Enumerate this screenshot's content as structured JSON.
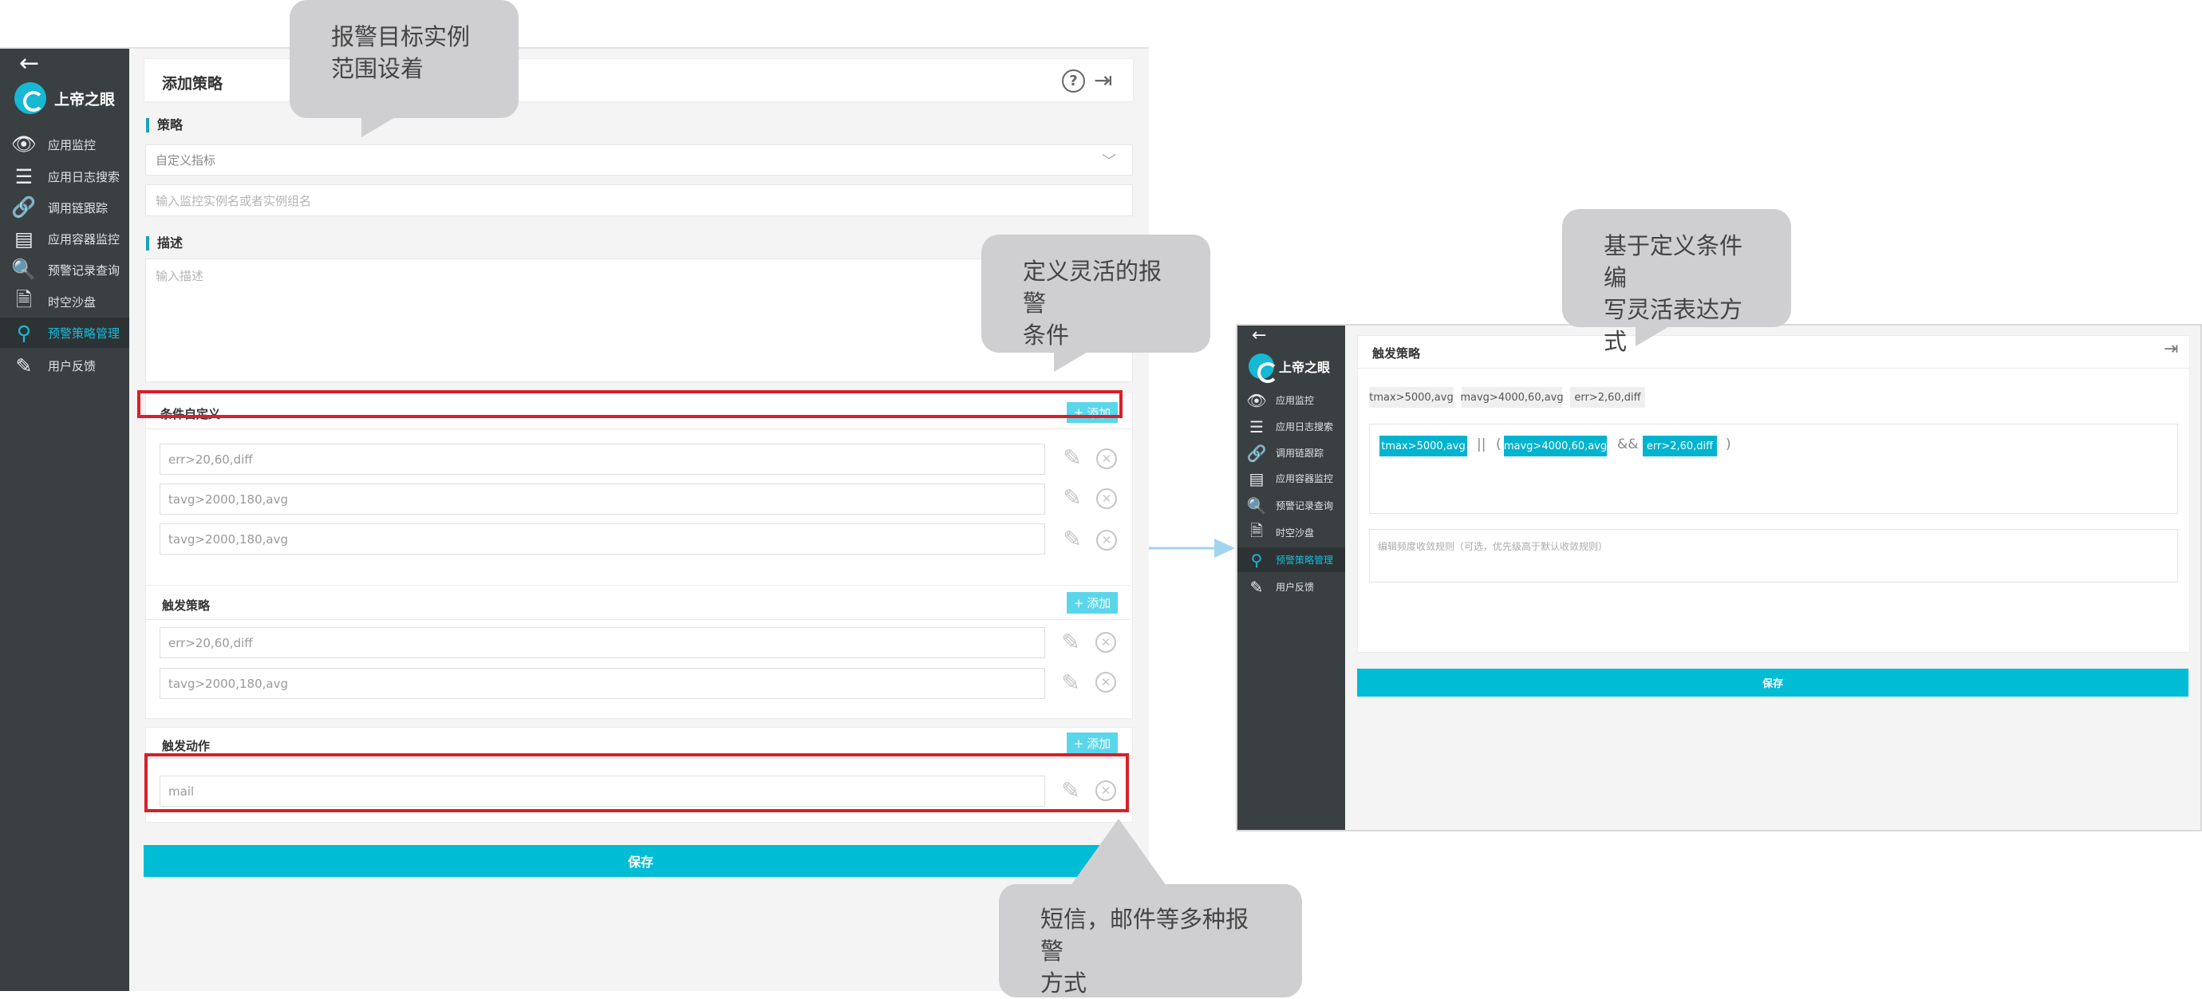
{
  "app": {
    "logo_text": "上帝之眼",
    "back_icon": "arrow-left-icon",
    "nav": [
      {
        "label": "应用监控",
        "icon": "eye-icon"
      },
      {
        "label": "应用日志搜索",
        "icon": "list-icon"
      },
      {
        "label": "调用链跟踪",
        "icon": "link-icon"
      },
      {
        "label": "应用容器监控",
        "icon": "server-icon"
      },
      {
        "label": "预警记录查询",
        "icon": "magnifier-icon"
      },
      {
        "label": "时空沙盘",
        "icon": "document-clock-icon"
      },
      {
        "label": "预警策略管理",
        "icon": "org-chart-icon",
        "active": true
      },
      {
        "label": "用户反馈",
        "icon": "feedback-icon"
      }
    ],
    "accent_color": "#00bcd4"
  },
  "left_panel": {
    "title": "添加策略",
    "strategy_label": "策略",
    "strategy_select": "自定义指标",
    "instance_placeholder": "输入监控实例名或者实例组名",
    "desc_label": "描述",
    "desc_placeholder": "输入描述",
    "conditions": {
      "title": "条件自定义",
      "add_label": "添加",
      "rows": [
        "err>20,60,diff",
        "tavg>2000,180,avg",
        "tavg>2000,180,avg"
      ]
    },
    "triggers": {
      "title": "触发策略",
      "add_label": "添加",
      "rows": [
        "err>20,60,diff",
        "tavg>2000,180,avg"
      ]
    },
    "actions": {
      "title": "触发动作",
      "add_label": "添加",
      "rows": [
        "mail"
      ]
    },
    "save_label": "保存"
  },
  "right_panel": {
    "title": "触发策略",
    "chips": [
      "tmax>5000,avg",
      "mavg>4000,60,avg",
      "err>2,60,diff"
    ],
    "expression": {
      "tags": [
        "tmax>5000,avg",
        "mavg>4000,60,avg",
        "err>2,60,diff"
      ],
      "op_or": "||",
      "open_paren": "(",
      "op_and": "&&",
      "close_paren": ")"
    },
    "rule_placeholder": "编辑频度收敛规则（可选，优先级高于默认收敛规则）",
    "save_label": "保存"
  },
  "callouts": {
    "target_scope": [
      "报警目标实例",
      "范围设着"
    ],
    "flexible_conditions": [
      "定义灵活的报警",
      "条件"
    ],
    "expression": [
      "基于定义条件编",
      "写灵活表达方式"
    ],
    "channels": [
      "短信，邮件等多种报警",
      "方式"
    ]
  }
}
